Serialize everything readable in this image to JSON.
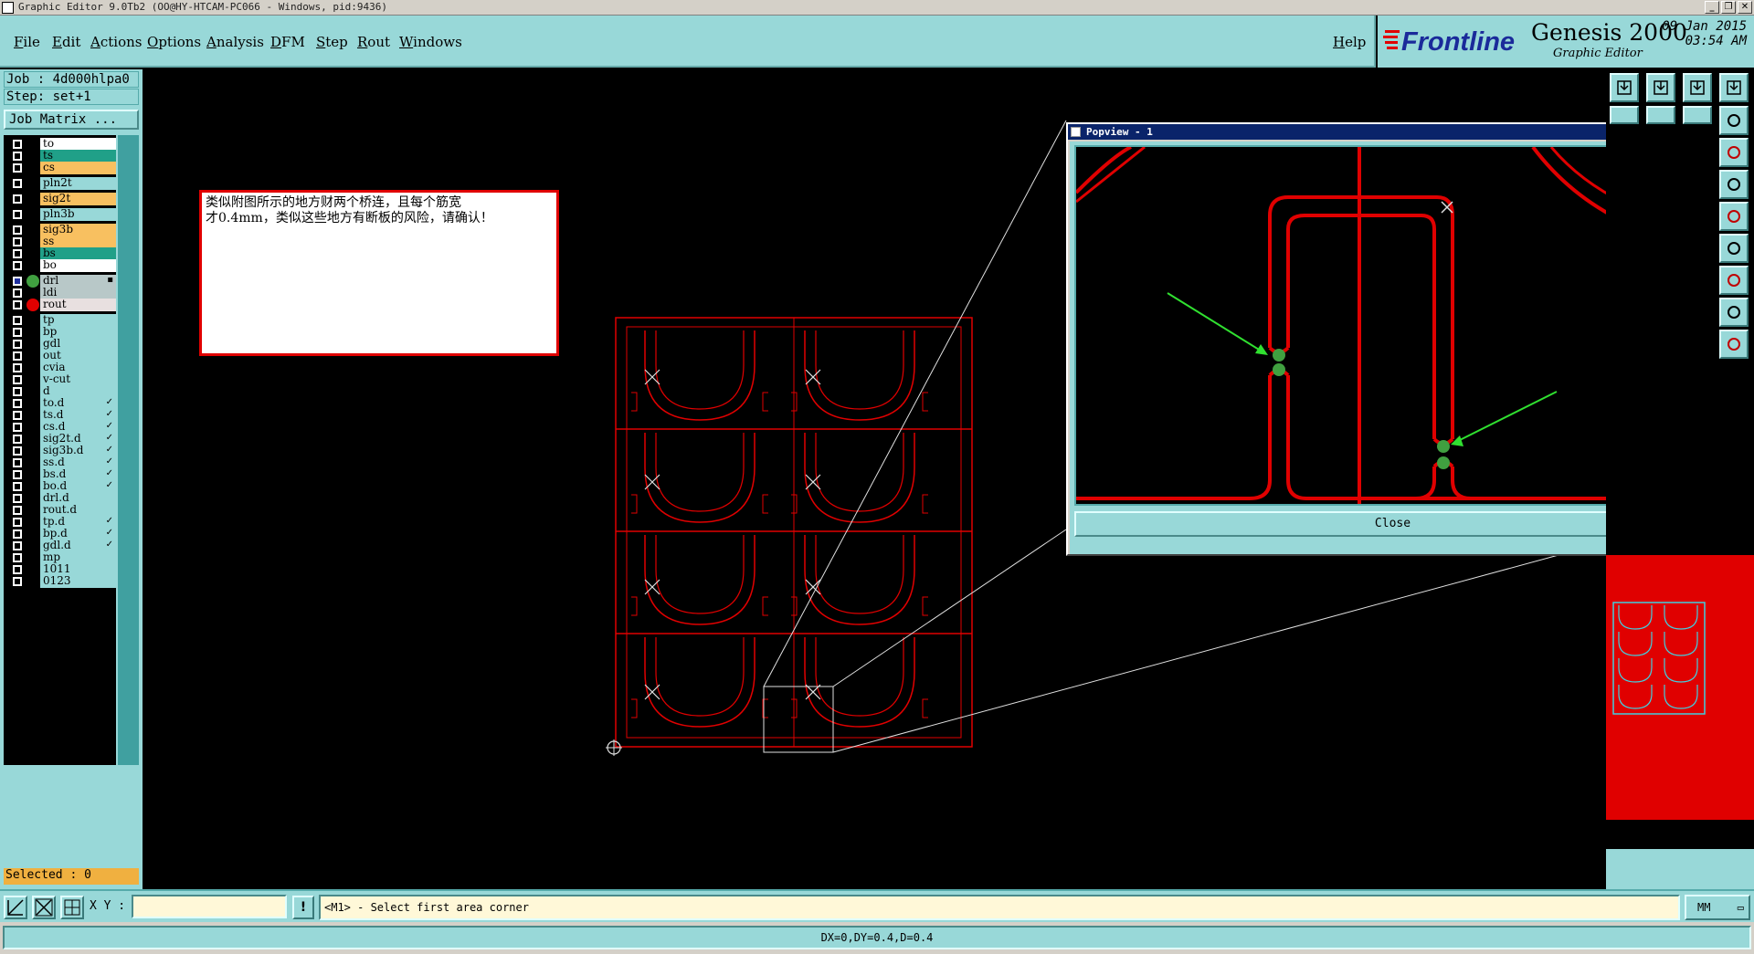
{
  "window": {
    "title": "Graphic Editor 9.0Tb2 (OO@HY-HTCAM-PC066 - Windows, pid:9436)",
    "controls": [
      "_",
      "❐",
      "✕"
    ]
  },
  "menu": [
    "File",
    "Edit",
    "Actions",
    "Options",
    "Analysis",
    "DFM",
    "Step",
    "Rout",
    "Windows"
  ],
  "help_label": "Help",
  "brand": {
    "logo": "Frontline",
    "product": "Genesis 2000",
    "subtitle": "Graphic Editor",
    "date": "09 Jan 2015",
    "time": "03:54 AM"
  },
  "job": {
    "job_label": "Job : 4d000hlpa0",
    "step_label": "Step: set+1",
    "matrix_button": "Job Matrix ..."
  },
  "layers": [
    {
      "name": "to",
      "color": "#ffffff"
    },
    {
      "name": "ts",
      "color": "#20a088"
    },
    {
      "name": "cs",
      "color": "#f8c060"
    },
    {
      "name": "pln2t",
      "color": "#98d8d8"
    },
    {
      "name": "sig2t",
      "color": "#f8c060"
    },
    {
      "name": "pln3b",
      "color": "#98d8d8"
    },
    {
      "name": "sig3b",
      "color": "#f8c060"
    },
    {
      "name": "ss",
      "color": "#f8c060"
    },
    {
      "name": "bs",
      "color": "#20a088"
    },
    {
      "name": "bo",
      "color": "#ffffff"
    },
    {
      "name": "drl",
      "color": "#b8c8c8",
      "dot": "#40a040",
      "mark": "▪"
    },
    {
      "name": "ldi",
      "color": "#b8c8c8"
    },
    {
      "name": "rout",
      "color": "#e8e0e0",
      "dot": "#e00000"
    },
    {
      "name": "tp",
      "color": "#98d8d8"
    },
    {
      "name": "bp",
      "color": "#98d8d8"
    },
    {
      "name": "gdl",
      "color": "#98d8d8"
    },
    {
      "name": "out",
      "color": "#98d8d8"
    },
    {
      "name": "cvia",
      "color": "#98d8d8"
    },
    {
      "name": "v-cut",
      "color": "#98d8d8"
    },
    {
      "name": "d",
      "color": "#98d8d8"
    },
    {
      "name": "to.d",
      "color": "#98d8d8",
      "mark": "✓"
    },
    {
      "name": "ts.d",
      "color": "#98d8d8",
      "mark": "✓"
    },
    {
      "name": "cs.d",
      "color": "#98d8d8",
      "mark": "✓"
    },
    {
      "name": "sig2t.d",
      "color": "#98d8d8",
      "mark": "✓"
    },
    {
      "name": "sig3b.d",
      "color": "#98d8d8",
      "mark": "✓"
    },
    {
      "name": "ss.d",
      "color": "#98d8d8",
      "mark": "✓"
    },
    {
      "name": "bs.d",
      "color": "#98d8d8",
      "mark": "✓"
    },
    {
      "name": "bo.d",
      "color": "#98d8d8",
      "mark": "✓"
    },
    {
      "name": "drl.d",
      "color": "#98d8d8"
    },
    {
      "name": "rout.d",
      "color": "#98d8d8"
    },
    {
      "name": "tp.d",
      "color": "#98d8d8",
      "mark": "✓"
    },
    {
      "name": "bp.d",
      "color": "#98d8d8",
      "mark": "✓"
    },
    {
      "name": "gdl.d",
      "color": "#98d8d8",
      "mark": "✓"
    },
    {
      "name": "mp",
      "color": "#98d8d8"
    },
    {
      "name": "1011",
      "color": "#98d8d8"
    },
    {
      "name": "0123",
      "color": "#98d8d8"
    }
  ],
  "selected_label": "Selected : 0",
  "note": {
    "line1": "类似附图所示的地方财两个桥连，且每个筋宽",
    "line2": "才0.4mm，类似这些地方有断板的风险，请确认！"
  },
  "popview": {
    "title": "Popview - 1",
    "close_button": "Close"
  },
  "bottom": {
    "xy_label": "X Y :",
    "xy_value": "",
    "info_button": "!",
    "prompt": "<M1> - Select first area corner",
    "units": "MM",
    "status": "DX=0,DY=0.4,D=0.4"
  },
  "colors": {
    "panel": "#98d8d8",
    "rout": "#e00000",
    "marker": "#40a040",
    "arrow": "#30e030"
  }
}
